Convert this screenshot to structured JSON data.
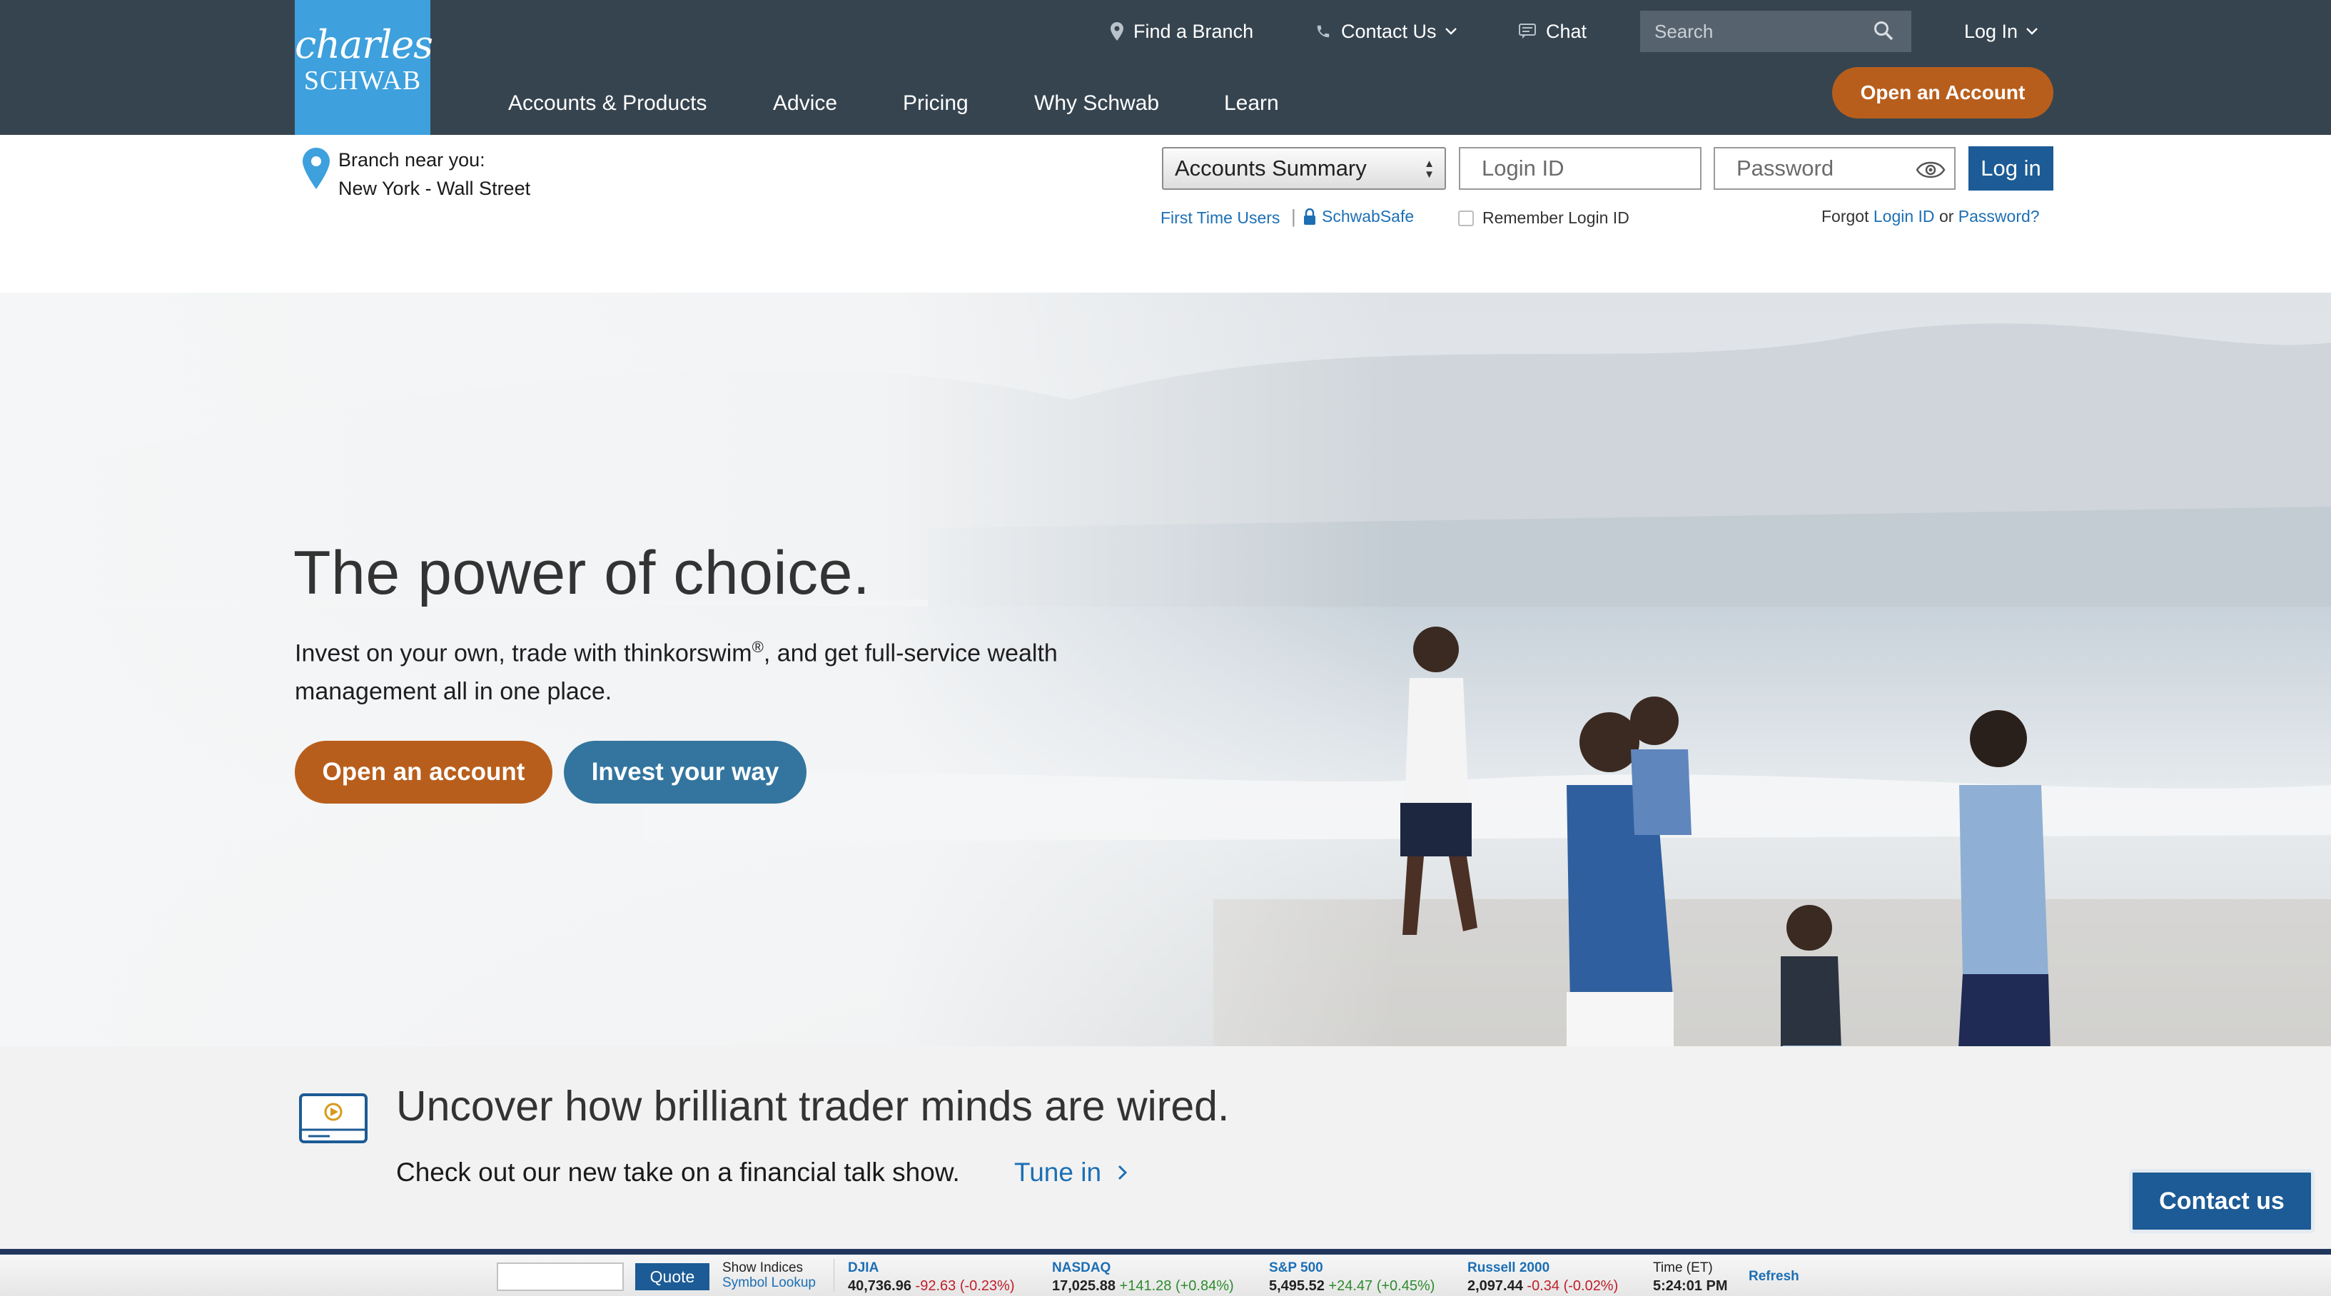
{
  "brand": {
    "line1": "charles",
    "line2": "SCHWAB"
  },
  "utility_nav": {
    "find_branch": "Find a Branch",
    "contact_us": "Contact Us",
    "chat": "Chat",
    "search_placeholder": "Search",
    "log_in": "Log In"
  },
  "main_nav": [
    "Accounts & Products",
    "Advice",
    "Pricing",
    "Why Schwab",
    "Learn"
  ],
  "open_account_top": "Open an Account",
  "branch": {
    "label": "Branch near you:",
    "name": "New York - Wall Street"
  },
  "login": {
    "account_select": "Accounts Summary",
    "login_id_placeholder": "Login ID",
    "password_placeholder": "Password",
    "login_button": "Log in",
    "first_time": "First Time Users",
    "separator": "|",
    "schwab_safe": "SchwabSafe",
    "remember": "Remember Login ID",
    "forgot_prefix": "Forgot",
    "forgot_login_id": "Login ID",
    "forgot_or": "or",
    "forgot_password": "Password?"
  },
  "hero": {
    "title": "The power of choice.",
    "body_part1": "Invest on your own, trade with thinkorswim",
    "body_reg": "®",
    "body_part2": ", and get full-service wealth management all in one place.",
    "cta_primary": "Open an account",
    "cta_secondary": "Invest your way"
  },
  "promo": {
    "title": "Uncover how brilliant trader minds are wired.",
    "subtitle": "Check out our new take on a financial talk show.",
    "link": "Tune in"
  },
  "contact_us_button": "Contact us",
  "ticker": {
    "quote_button": "Quote",
    "show_indices": "Show Indices",
    "symbol_lookup": "Symbol Lookup",
    "indices": [
      {
        "name": "DJIA",
        "value": "40,736.96",
        "change": "-92.63 (-0.23%)",
        "direction": "down"
      },
      {
        "name": "NASDAQ",
        "value": "17,025.88",
        "change": "+141.28 (+0.84%)",
        "direction": "up"
      },
      {
        "name": "S&P 500",
        "value": "5,495.52",
        "change": "+24.47 (+0.45%)",
        "direction": "up"
      },
      {
        "name": "Russell 2000",
        "value": "2,097.44",
        "change": "-0.34 (-0.02%)",
        "direction": "down"
      }
    ],
    "time_label": "Time (ET)",
    "time_value": "5:24:01 PM",
    "refresh": "Refresh"
  },
  "colors": {
    "header_bg": "#36444f",
    "logo_bg": "#3ea0dd",
    "orange_cta": "#b85e1c",
    "blue_cta": "#33759f",
    "link_blue": "#1c6fb5",
    "dark_blue_button": "#1c5b95",
    "negative": "#c0202a",
    "positive": "#2e8b2e"
  }
}
